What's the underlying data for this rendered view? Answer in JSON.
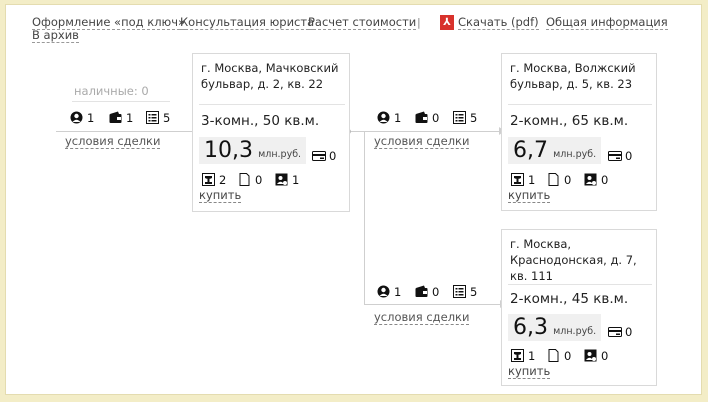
{
  "nav": {
    "items": [
      "Оформление «под ключ»",
      "Консультация юриста",
      "Расчет стоимости",
      "Скачать (pdf)",
      "Общая информация",
      "В архив"
    ],
    "separator": "|",
    "pdf_icon": "pdf-icon"
  },
  "source": {
    "cash_label": "наличные: 0",
    "persons": "1",
    "wallets": "1",
    "docs": "5",
    "conditions": "условия сделки"
  },
  "branch1": {
    "persons": "1",
    "wallets": "0",
    "docs": "5",
    "conditions": "условия сделки"
  },
  "branch2": {
    "persons": "1",
    "wallets": "0",
    "docs": "5",
    "conditions": "условия сделки"
  },
  "cards": [
    {
      "address": "г. Москва, Мачковский бульвар, д. 2, кв. 22",
      "rooms": "3-комн., 50 кв.м.",
      "price": "10,3",
      "price_unit": "млн.руб.",
      "card_count": "0",
      "owners": "2",
      "documents": "0",
      "registered": "1",
      "buy": "купить"
    },
    {
      "address": "г. Москва, Волжский бульвар, д. 5, кв. 23",
      "rooms": "2-комн., 65 кв.м.",
      "price": "6,7",
      "price_unit": "млн.руб.",
      "card_count": "0",
      "owners": "1",
      "documents": "0",
      "registered": "0",
      "buy": "купить"
    },
    {
      "address": "г. Москва, Краснодонская, д. 7, кв. 111",
      "rooms": "2-комн., 45 кв.м.",
      "price": "6,3",
      "price_unit": "млн.руб.",
      "card_count": "0",
      "owners": "1",
      "documents": "0",
      "registered": "0",
      "buy": "купить"
    }
  ],
  "colors": {
    "page_bg": "#f3edc7",
    "pdf_red": "#d8322c",
    "line": "#cfcfcf"
  }
}
